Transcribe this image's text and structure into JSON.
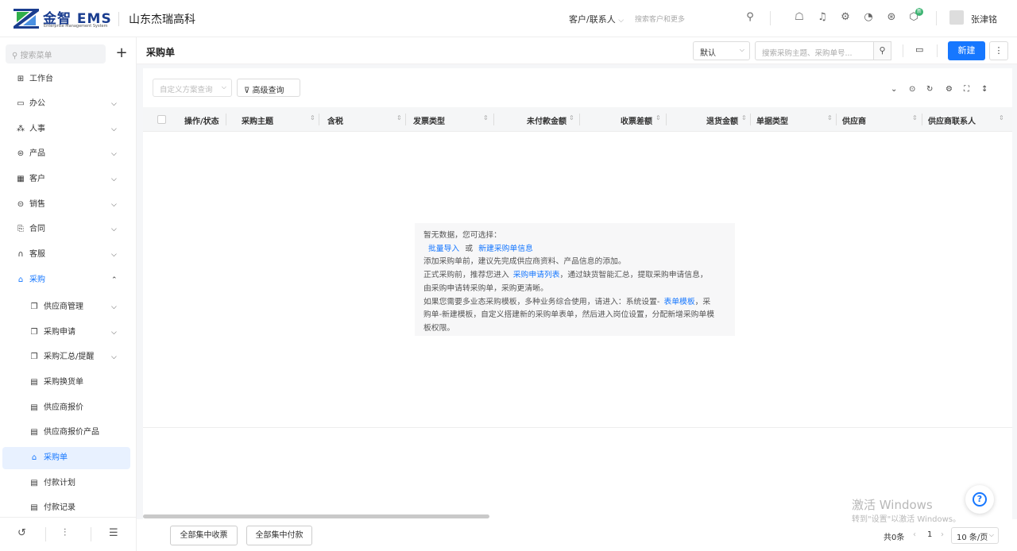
{
  "topbar": {
    "brand": "金智 EMS",
    "brand_sub": "Enterprise Management System",
    "company": "山东杰瑞高科",
    "scope_label": "客户/联系人",
    "search_placeholder": "搜索客户和更多",
    "notification_badge": "新",
    "username": "张津铭"
  },
  "sidebar": {
    "search_placeholder": "搜索菜单",
    "items": [
      {
        "label": "工作台",
        "icon": "dashboard-icon"
      },
      {
        "label": "办公",
        "icon": "office-icon"
      },
      {
        "label": "人事",
        "icon": "hr-icon"
      },
      {
        "label": "产品",
        "icon": "product-icon"
      },
      {
        "label": "客户",
        "icon": "customer-icon"
      },
      {
        "label": "销售",
        "icon": "sales-icon"
      },
      {
        "label": "合同",
        "icon": "contract-icon"
      },
      {
        "label": "客服",
        "icon": "service-icon"
      },
      {
        "label": "采购",
        "icon": "purchase-icon"
      }
    ],
    "sub_items": [
      {
        "label": "供应商管理"
      },
      {
        "label": "采购申请"
      },
      {
        "label": "采购汇总/提醒"
      },
      {
        "label": "采购换货单"
      },
      {
        "label": "供应商报价"
      },
      {
        "label": "供应商报价产品"
      },
      {
        "label": "采购单"
      },
      {
        "label": "付款计划"
      },
      {
        "label": "付款记录"
      }
    ]
  },
  "main": {
    "page_title": "采购单",
    "view_select": "默认",
    "search_placeholder": "搜索采购主题、采购单号...",
    "new_button": "新建",
    "custom_query_placeholder": "自定义方案查询",
    "advanced_query": "高级查询",
    "columns": [
      "操作/状态",
      "采购主题",
      "含税",
      "发票类型",
      "未付款金额",
      "收票差额",
      "退货金额",
      "单据类型",
      "供应商",
      "供应商联系人"
    ],
    "empty": {
      "line1": "暂无数据，您可选择：",
      "link_import": "批量导入",
      "or": "或",
      "link_new": "新建采购单信息",
      "line3": "添加采购单前，建议先完成供应商资料、产品信息的添加。",
      "line4_a": "正式采购前，推荐您进入",
      "link_request_list": "采购申请列表",
      "line4_b": "，通过缺货智能汇总，提取采购申请信息，",
      "line5": "由采购申请转采购单，采购更清晰。",
      "line6_a": "如果您需要多业态采购模板，多种业务综合使用，请进入：系统设置-",
      "link_form_template": "表单模板",
      "line6_b": "，采",
      "line7": "购单-新建模板，自定义搭建新的采购单表单，然后进入岗位设置，分配新增采购单模",
      "line8": "板权限。"
    },
    "footer": {
      "btn_collect": "全部集中收票",
      "btn_pay": "全部集中付款",
      "total": "共0条",
      "page": "1",
      "page_size": "10 条/页"
    }
  },
  "watermark": {
    "title": "激活 Windows",
    "sub": "转到\"设置\"以激活 Windows。"
  }
}
